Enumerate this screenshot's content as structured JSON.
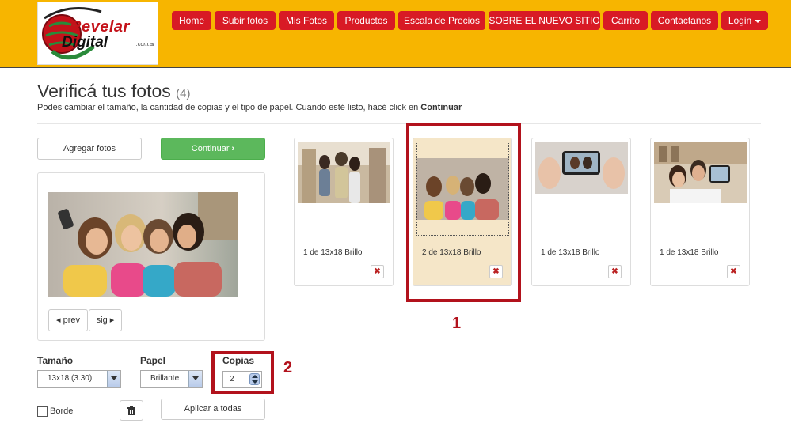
{
  "brand": {
    "name_line1": "Revelar",
    "name_line2": "Digital",
    "domain_suffix": ".com.ar"
  },
  "nav": {
    "items": [
      {
        "label": "Home"
      },
      {
        "label": "Subir fotos"
      },
      {
        "label": "Mis Fotos"
      },
      {
        "label": "Productos"
      },
      {
        "label": "Escala de Precios"
      },
      {
        "label": "SOBRE EL NUEVO SITIO"
      },
      {
        "label": "Carrito"
      },
      {
        "label": "Contactanos"
      },
      {
        "label": "Login"
      }
    ]
  },
  "page": {
    "title": "Verificá tus fotos",
    "count": "(4)",
    "subtitle_pre": "Podés cambiar el tamaño, la cantidad de copias y el tipo de papel. Cuando esté listo, hacé click en",
    "subtitle_strong": "Continuar"
  },
  "actions": {
    "add_photos": "Agregar fotos",
    "continue": "Continuar"
  },
  "preview": {
    "prev": "prev",
    "next": "sig"
  },
  "options": {
    "size_label": "Tamaño",
    "size_value": "13x18 (3.30)",
    "paper_label": "Papel",
    "paper_value": "Brillante",
    "copies_label": "Copias",
    "copies_value": "2",
    "border_label": "Borde",
    "apply_all": "Aplicar a todas"
  },
  "photos": [
    {
      "caption": "1 de 13x18 Brillo",
      "selected": false
    },
    {
      "caption": "2 de 13x18 Brillo",
      "selected": true
    },
    {
      "caption": "1 de 13x18 Brillo",
      "selected": false
    },
    {
      "caption": "1 de 13x18 Brillo",
      "selected": false
    }
  ],
  "annotations": {
    "marker1": "1",
    "marker2": "2"
  },
  "colors": {
    "header": "#f7b500",
    "nav_button": "#d81a25",
    "continue_button": "#5cb85c",
    "annotation": "#b2121c"
  }
}
